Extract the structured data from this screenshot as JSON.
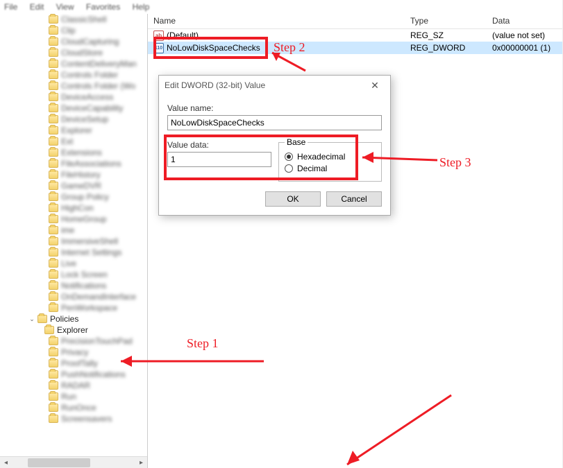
{
  "menu": {
    "file": "File",
    "edit": "Edit",
    "view": "View",
    "favorites": "Favorites",
    "help": "Help"
  },
  "tree": {
    "policies": "Policies",
    "explorer": "Explorer"
  },
  "list": {
    "headers": {
      "name": "Name",
      "type": "Type",
      "data": "Data"
    },
    "rows": [
      {
        "icon": "ab",
        "name": "(Default)",
        "type": "REG_SZ",
        "data": "(value not set)"
      },
      {
        "icon": "110",
        "name": "NoLowDiskSpaceChecks",
        "type": "REG_DWORD",
        "data": "0x00000001 (1)"
      }
    ]
  },
  "dialog": {
    "title": "Edit DWORD (32-bit) Value",
    "valueNameLabel": "Value name:",
    "valueName": "NoLowDiskSpaceChecks",
    "valueDataLabel": "Value data:",
    "valueData": "1",
    "baseLabel": "Base",
    "hex": "Hexadecimal",
    "dec": "Decimal",
    "ok": "OK",
    "cancel": "Cancel"
  },
  "annotations": {
    "step1": "Step 1",
    "step2": "Step 2",
    "step3": "Step 3"
  }
}
